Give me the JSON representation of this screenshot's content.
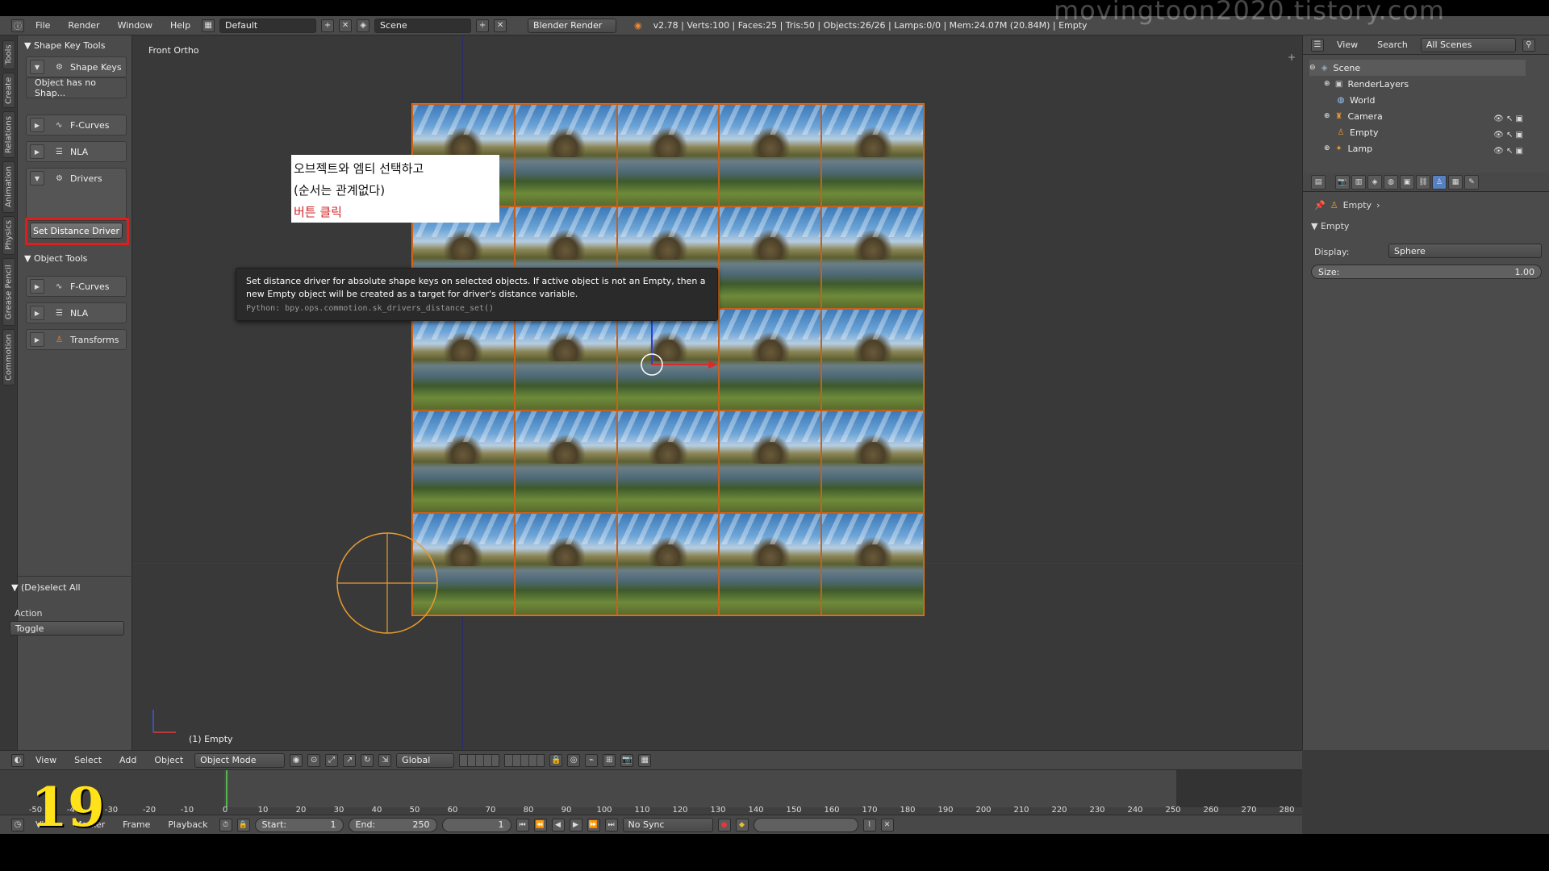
{
  "watermark": "movingtoon2020.tistory.com",
  "step_number": "19",
  "topbar": {
    "menus": [
      "File",
      "Render",
      "Window",
      "Help"
    ],
    "layout": "Default",
    "scene": "Scene",
    "engine": "Blender Render",
    "stats": "v2.78 | Verts:100 | Faces:25 | Tris:50 | Objects:26/26 | Lamps:0/0 | Mem:24.07M (20.84M) | Empty"
  },
  "tabs": [
    "Tools",
    "Create",
    "Relations",
    "Animation",
    "Physics",
    "Grease Pencil",
    "Commotion"
  ],
  "toolshelf": {
    "shape_key_tools": "Shape Key Tools",
    "shape_keys": "Shape Keys",
    "no_shape": "Object has no Shap...",
    "fcurves": "F-Curves",
    "nla": "NLA",
    "drivers": "Drivers",
    "set_distance_driver": "Set Distance Driver",
    "object_tools": "Object Tools",
    "fcurves2": "F-Curves",
    "nla2": "NLA",
    "transforms": "Transforms",
    "deselect_all": "(De)select All",
    "action_label": "Action",
    "action_value": "Toggle"
  },
  "viewport": {
    "view_label": "Front Ortho",
    "object_label": "(1) Empty",
    "tooltip_desc": "Set distance driver for absolute shape keys on selected objects. If active object is not an Empty, then a new Empty object will be created as a target for driver's distance variable.",
    "tooltip_python": "Python: bpy.ops.commotion.sk_drivers_distance_set()",
    "note_line1": "오브젝트와 엠티 선택하고",
    "note_line2": "(순서는 관계없다)",
    "note_line3": "버튼 클릭"
  },
  "outliner": {
    "view": "View",
    "search": "Search",
    "filter": "All Scenes",
    "items": [
      "Scene",
      "RenderLayers",
      "World",
      "Camera",
      "Empty",
      "Lamp"
    ]
  },
  "props": {
    "object_name": "Empty",
    "panel_title": "Empty",
    "display_label": "Display:",
    "display_value": "Sphere",
    "size_label": "Size:",
    "size_value": "1.00"
  },
  "vp_header": {
    "menus": [
      "View",
      "Select",
      "Add",
      "Object"
    ],
    "mode": "Object Mode",
    "orientation": "Global"
  },
  "timeline": {
    "ticks": [
      "-50",
      "-40",
      "-30",
      "-20",
      "-10",
      "0",
      "10",
      "20",
      "30",
      "40",
      "50",
      "60",
      "70",
      "80",
      "90",
      "100",
      "110",
      "120",
      "130",
      "140",
      "150",
      "160",
      "170",
      "180",
      "190",
      "200",
      "210",
      "220",
      "230",
      "240",
      "250",
      "260",
      "270",
      "280"
    ]
  },
  "tl_header": {
    "menus": [
      "View",
      "Marker",
      "Frame",
      "Playback"
    ],
    "start_label": "Start:",
    "start_value": "1",
    "end_label": "End:",
    "end_value": "250",
    "current_frame": "1",
    "sync": "No Sync"
  },
  "colors": {
    "highlight": "#e01d1d",
    "selection_outline": "#e07a1a",
    "note_red": "#d2262a",
    "step_number": "#ffe21a"
  }
}
